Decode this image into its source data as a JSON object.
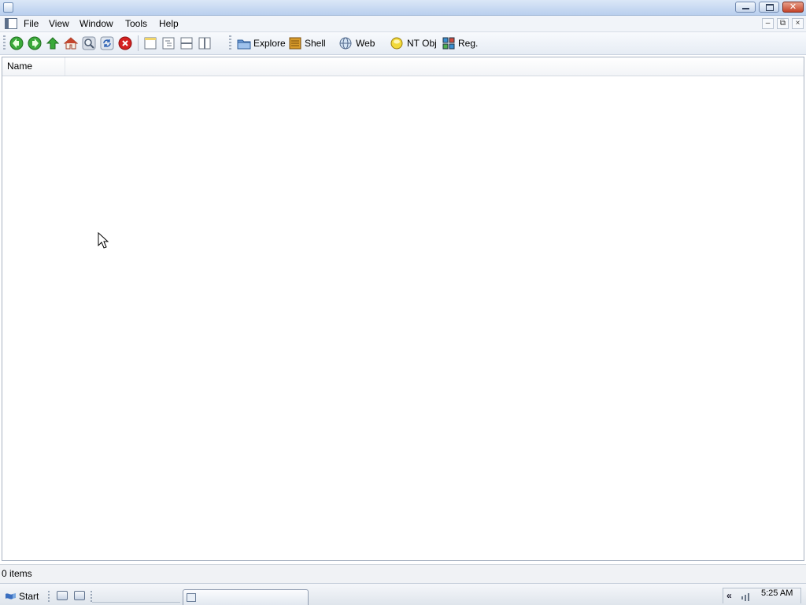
{
  "menu": {
    "items": [
      "File",
      "View",
      "Window",
      "Tools",
      "Help"
    ]
  },
  "mdi_controls": {
    "minimize": "–",
    "restore": "⧉",
    "close": "×"
  },
  "toolbar": {
    "nav_icons": [
      "back-arrow-icon",
      "forward-arrow-icon",
      "up-arrow-icon",
      "home-icon",
      "search-icon",
      "refresh-icon",
      "stop-icon"
    ],
    "view_icons": [
      "single-pane-icon",
      "tree-pane-icon",
      "horizontal-split-icon",
      "vertical-split-icon"
    ],
    "buttons": [
      {
        "label": "Explore",
        "icon": "folder-icon"
      },
      {
        "label": "Shell",
        "icon": "shell-icon"
      },
      {
        "label": "Web",
        "icon": "globe-icon"
      },
      {
        "label": "NT Obj",
        "icon": "nt-object-icon"
      },
      {
        "label": "Reg.",
        "icon": "registry-icon"
      }
    ]
  },
  "listview": {
    "columns": [
      "Name"
    ],
    "rows": []
  },
  "status": {
    "text": "0 items"
  },
  "taskbar": {
    "start_label": "Start",
    "tray_chevron": "«",
    "clock": "5:25 AM"
  },
  "colors": {
    "accent_green": "#2e9a2e",
    "stop_red": "#d42020",
    "titlebar": "#c6d8f0"
  }
}
